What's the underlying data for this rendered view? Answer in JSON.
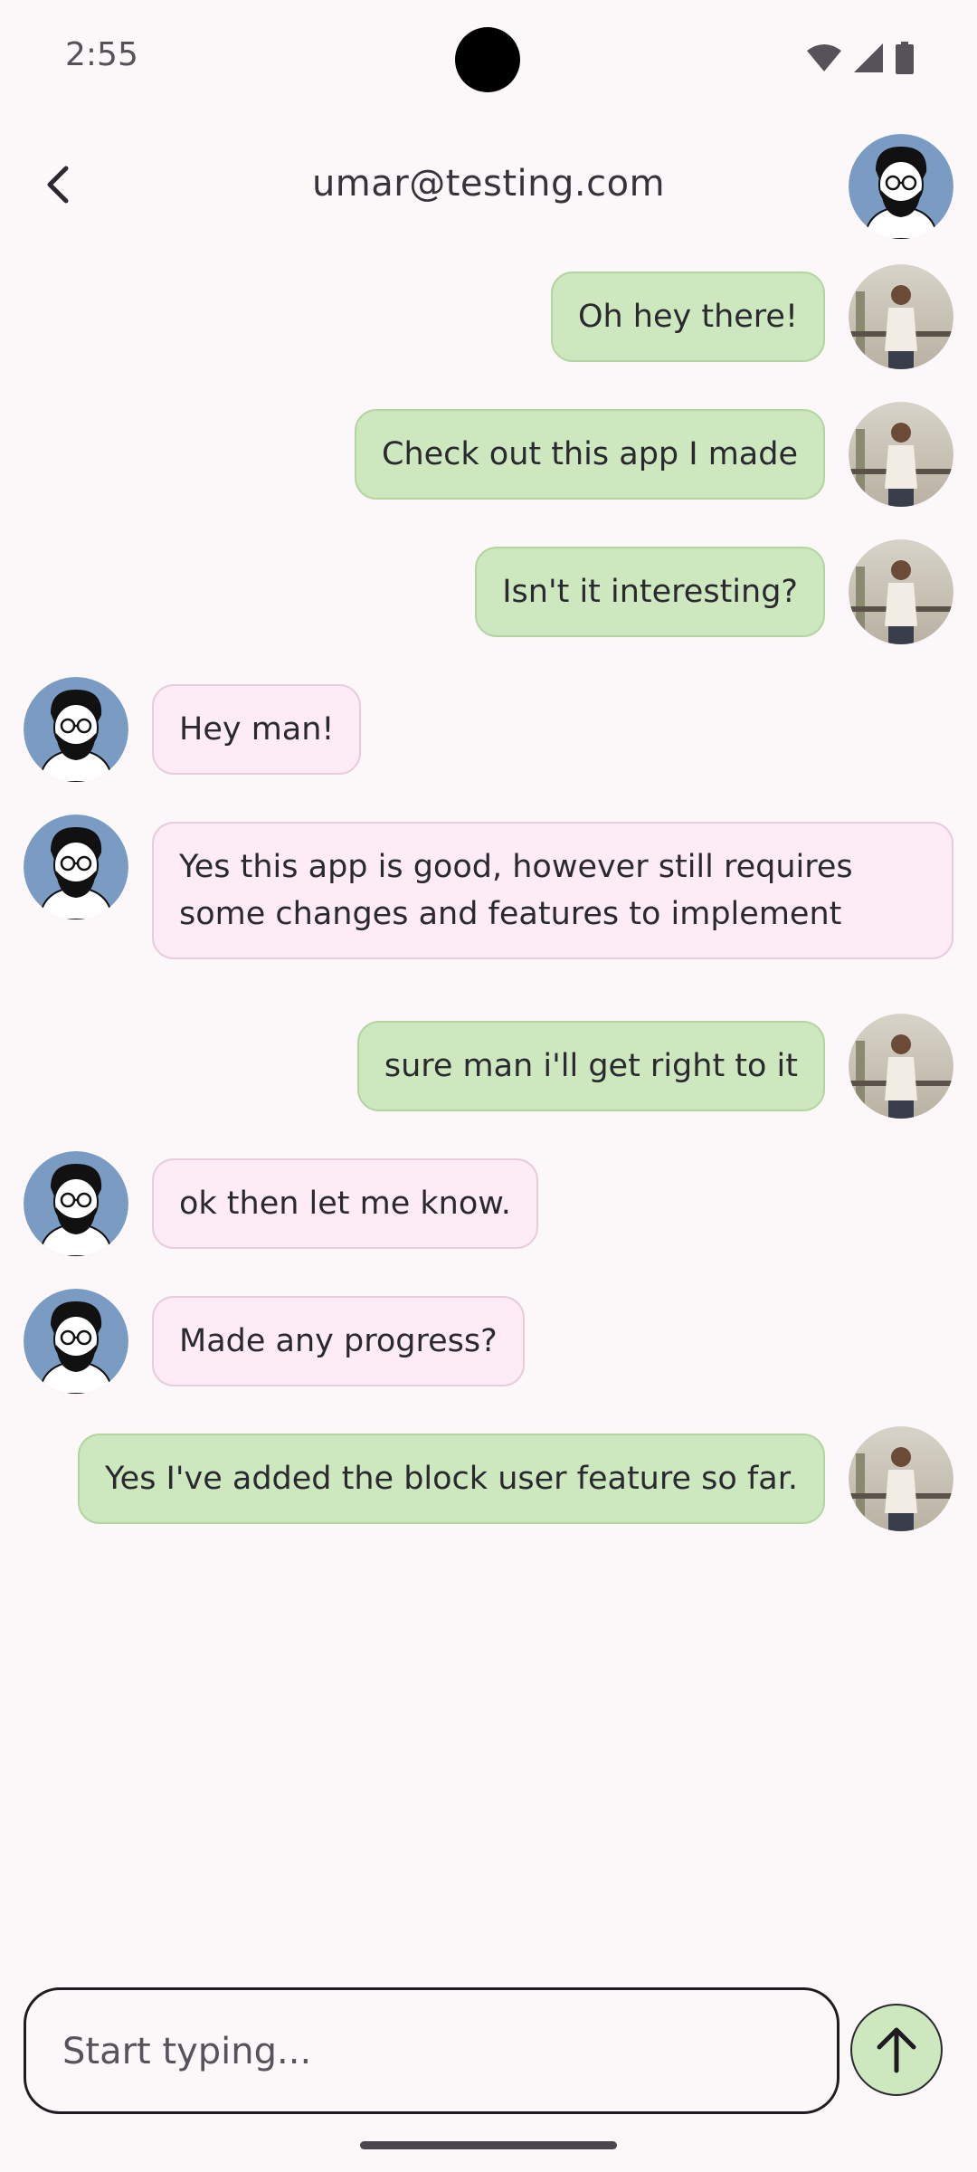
{
  "status_bar": {
    "time": "2:55"
  },
  "header": {
    "title": "umar@testing.com"
  },
  "messages": [
    {
      "from": "me",
      "text": "Oh hey there!"
    },
    {
      "from": "me",
      "text": "Check out this app I made"
    },
    {
      "from": "me",
      "text": "Isn't it interesting?"
    },
    {
      "from": "them",
      "text": "Hey man!"
    },
    {
      "from": "them",
      "text": "Yes this app is good, however still requires some changes and features to implement"
    },
    {
      "from": "me",
      "text": "sure man i'll get right to it"
    },
    {
      "from": "them",
      "text": "ok then let me know."
    },
    {
      "from": "them",
      "text": "Made any progress?"
    },
    {
      "from": "me",
      "text": "Yes I've added the block user feature so far."
    }
  ],
  "composer": {
    "placeholder": "Start typing...",
    "value": ""
  },
  "colors": {
    "background": "#fcf7f9",
    "sent_bubble": "#cde8be",
    "received_bubble": "#fdecf6",
    "send_button": "#cde8be"
  },
  "icons": {
    "back": "arrow-back-icon",
    "send": "arrow-up-icon",
    "wifi": "wifi-icon",
    "signal": "signal-icon",
    "battery": "battery-icon"
  }
}
